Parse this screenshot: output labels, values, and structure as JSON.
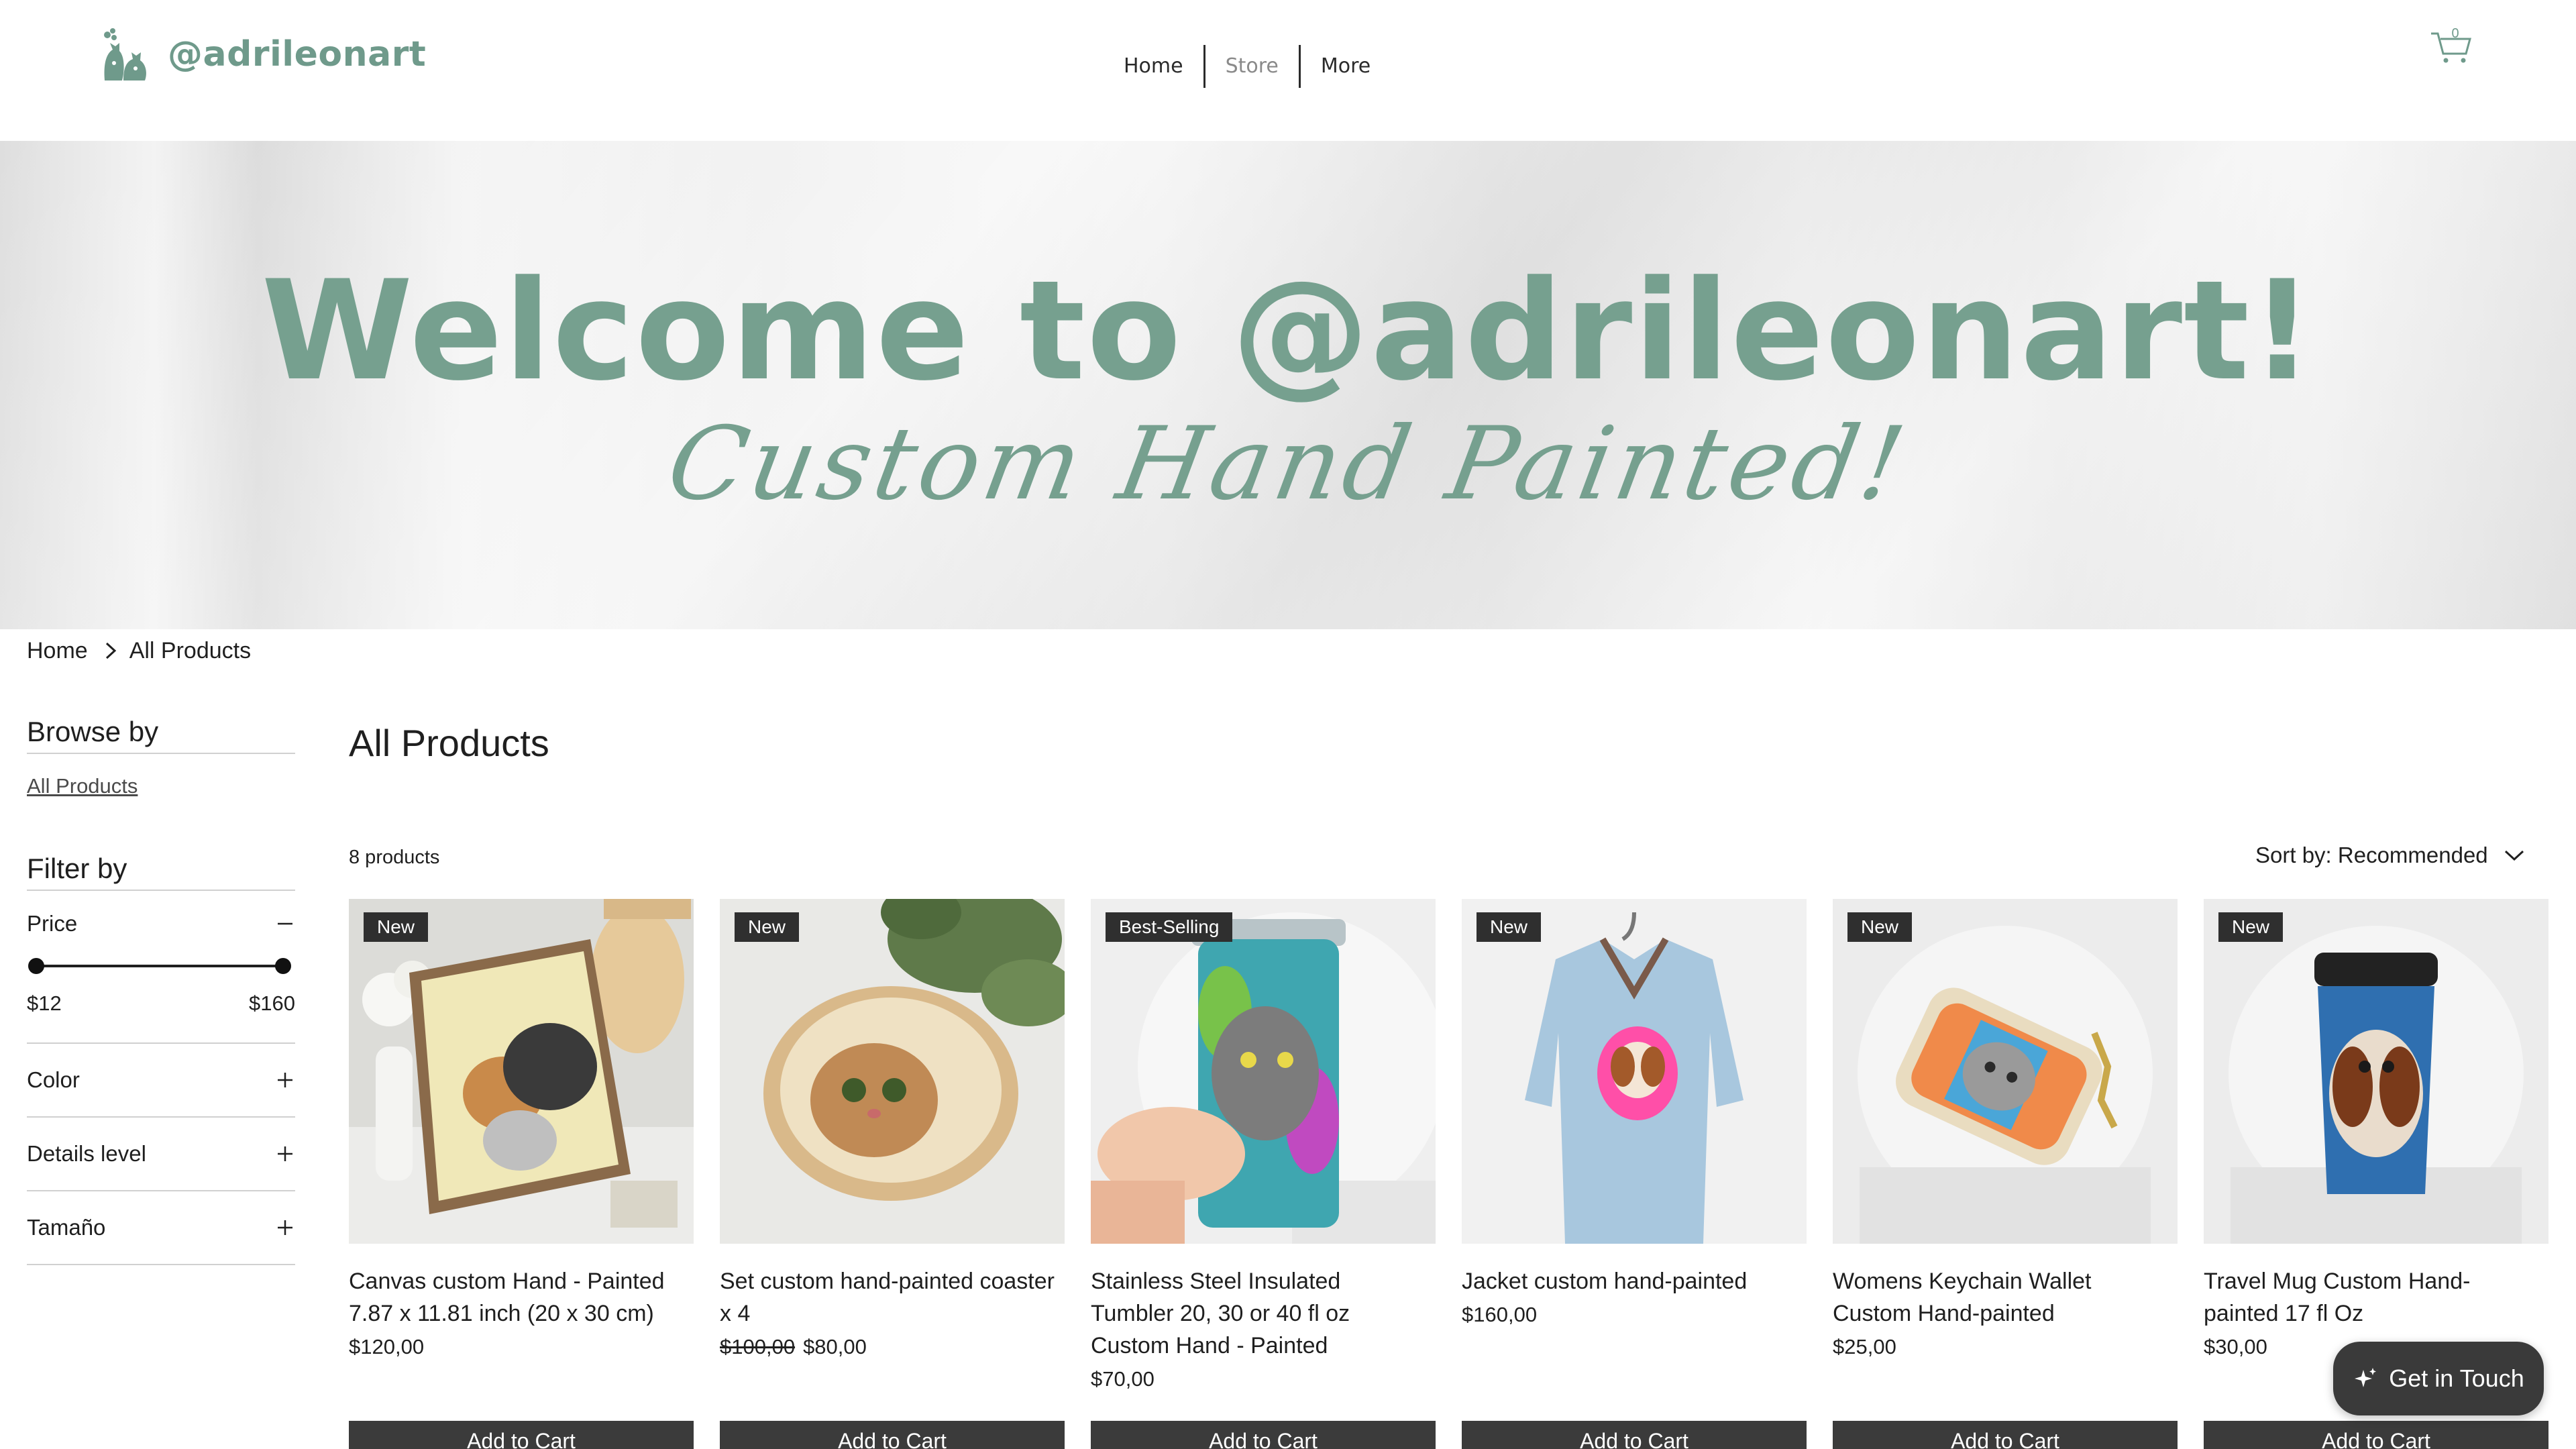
{
  "brand": {
    "name": "@adrileonart",
    "accent": "#6f9a8b"
  },
  "nav": {
    "items": [
      "Home",
      "Store",
      "More"
    ],
    "active": "Store"
  },
  "cart": {
    "count": "0",
    "icon": "cart-icon"
  },
  "banner": {
    "title": "Welcome to @adrileonart!",
    "subtitle": "Custom Hand Painted!"
  },
  "breadcrumb": {
    "home": "Home",
    "current": "All Products"
  },
  "sidebar": {
    "browse_title": "Browse by",
    "browse_link": "All Products",
    "filter_title": "Filter by",
    "price": {
      "label": "Price",
      "min": "$12",
      "max": "$160"
    },
    "filters": [
      "Color",
      "Details level",
      "Tamaño"
    ]
  },
  "main": {
    "title": "All Products",
    "count": "8 products",
    "sort": "Sort by: Recommended"
  },
  "products": [
    {
      "badge": "New",
      "name": "Canvas custom Hand - Painted 7.87 x 11.81 inch (20 x 30 cm)",
      "price": "$120,00",
      "old_price": "",
      "button": "Add to Cart"
    },
    {
      "badge": "New",
      "name": "Set custom hand-painted coaster x 4",
      "price": "$80,00",
      "old_price": "$100,00",
      "button": "Add to Cart"
    },
    {
      "badge": "Best-Selling",
      "name": "Stainless Steel Insulated Tumbler 20, 30 or 40 fl oz Custom Hand - Painted",
      "price": "$70,00",
      "old_price": "",
      "button": "Add to Cart"
    },
    {
      "badge": "New",
      "name": "Jacket custom hand-painted",
      "price": "$160,00",
      "old_price": "",
      "button": "Add to Cart"
    },
    {
      "badge": "New",
      "name": "Womens Keychain Wallet Custom Hand-painted",
      "price": "$25,00",
      "old_price": "",
      "button": "Add to Cart"
    },
    {
      "badge": "New",
      "name": "Travel Mug Custom Hand-painted 17 fl Oz",
      "price": "$30,00",
      "old_price": "",
      "button": "Add to Cart"
    }
  ],
  "contact": {
    "label": "Get in Touch"
  }
}
